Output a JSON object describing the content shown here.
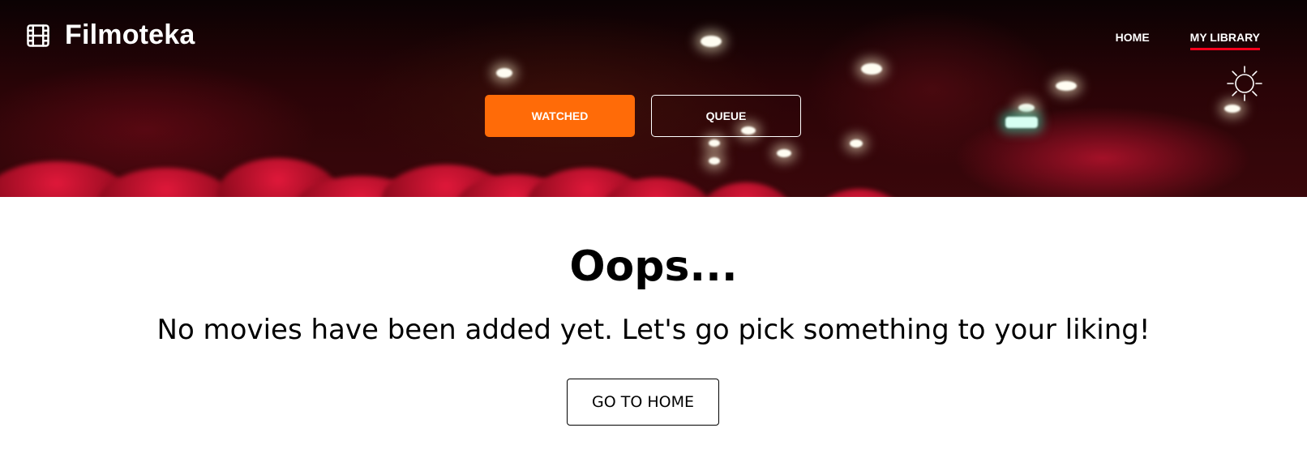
{
  "header": {
    "logo_icon": "film-icon",
    "logo_text": "Filmoteka",
    "nav": [
      {
        "label": "HOME",
        "active": false
      },
      {
        "label": "MY LIBRARY",
        "active": true
      }
    ],
    "theme_toggle_icon": "sun-icon",
    "library_buttons": {
      "watched_label": "WATCHED",
      "queue_label": "QUEUE"
    }
  },
  "empty_state": {
    "title": "Oops...",
    "message": "No movies have been added yet. Let's go pick something to your liking!",
    "button_label": "GO TO HOME"
  },
  "colors": {
    "accent_orange": "#ff6b08",
    "active_underline": "#ff001b",
    "text_dark": "#000000",
    "text_light": "#ffffff"
  }
}
